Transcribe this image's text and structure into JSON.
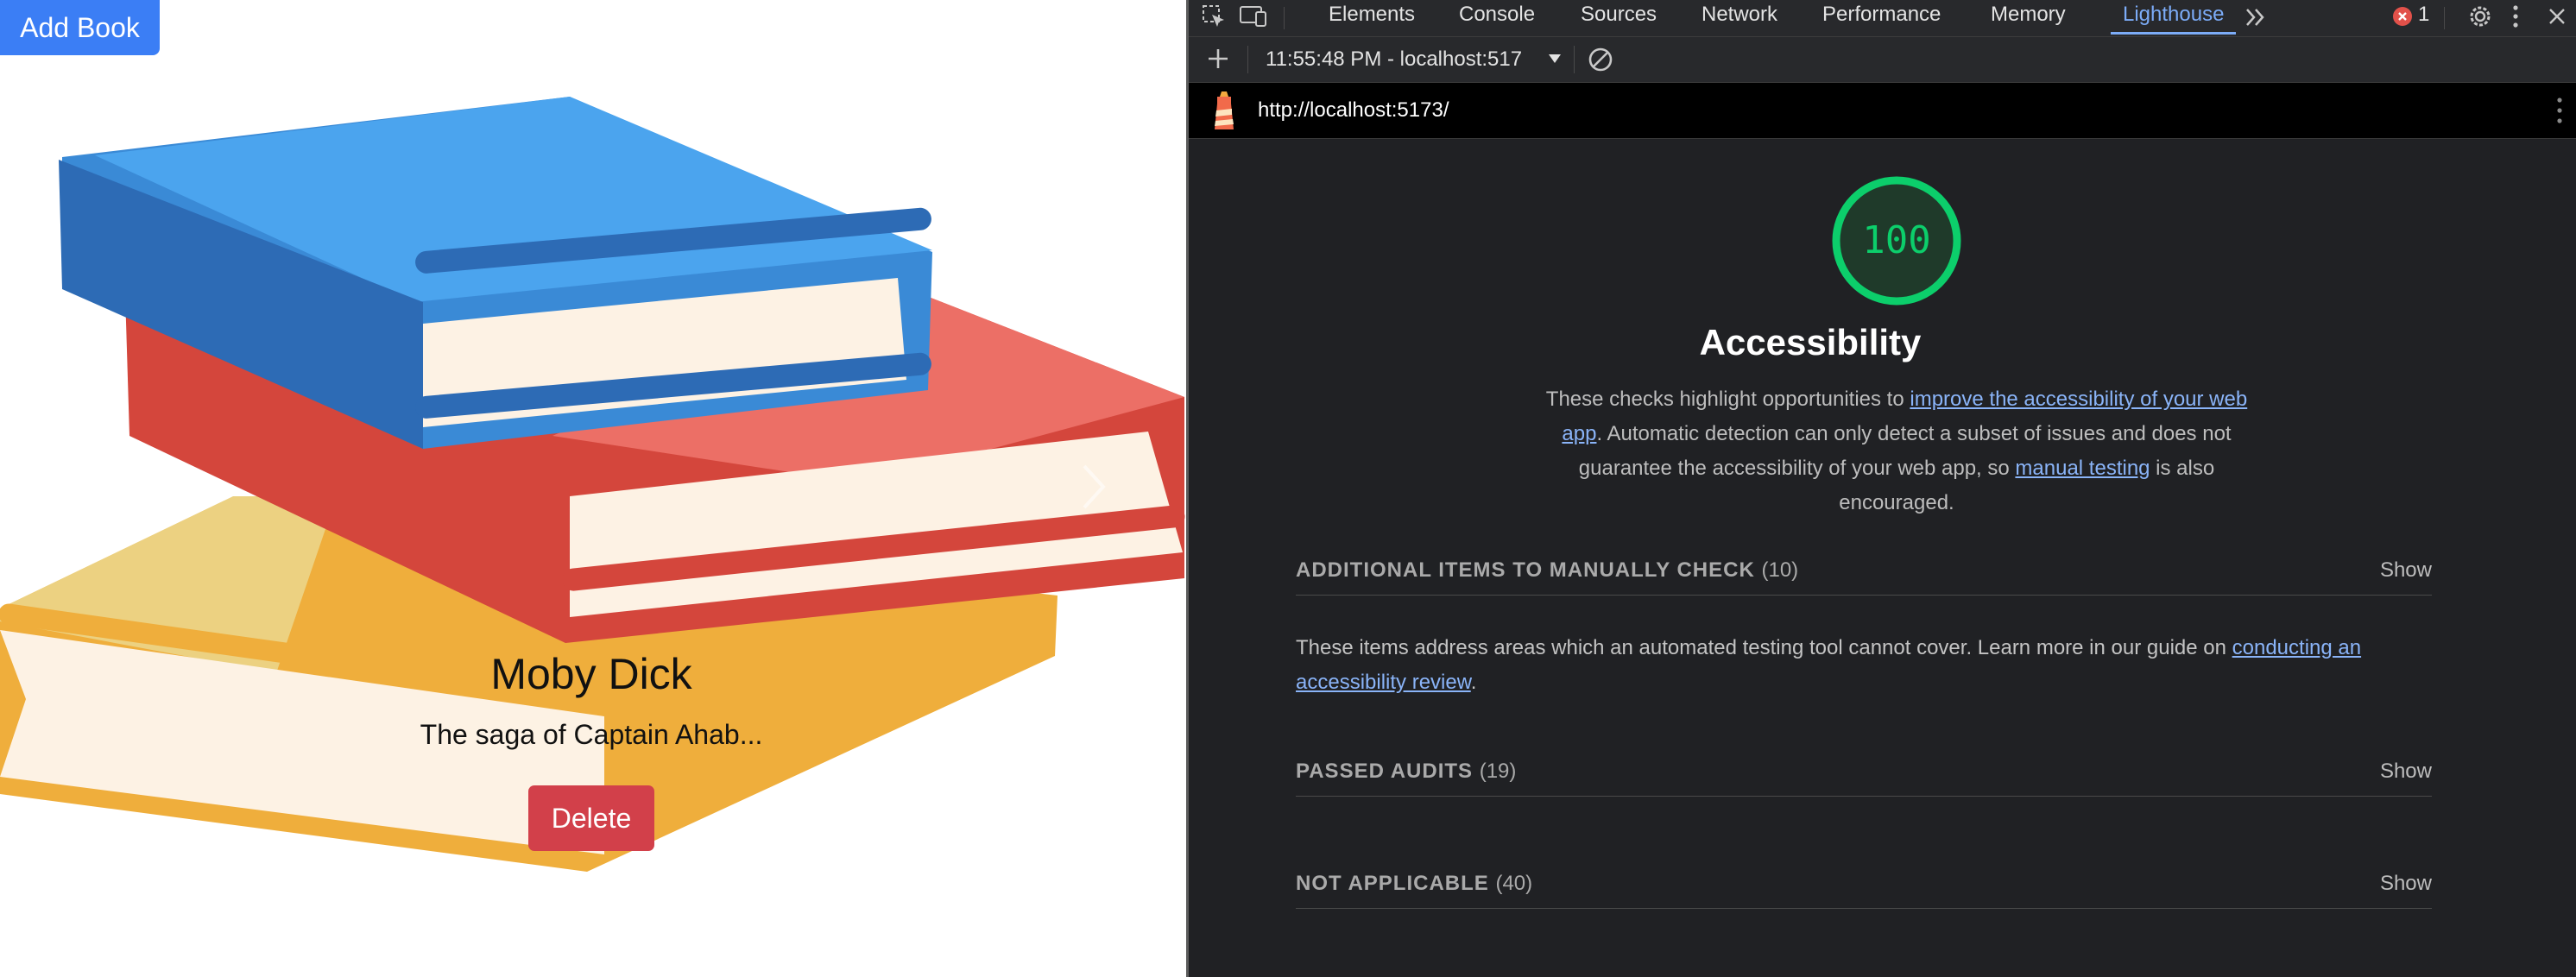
{
  "app": {
    "add_book_label": "Add Book",
    "book": {
      "title": "Moby Dick",
      "description": "The saga of Captain Ahab...",
      "delete_label": "Delete"
    }
  },
  "devtools": {
    "tabs": [
      "Elements",
      "Console",
      "Sources",
      "Network",
      "Performance",
      "Memory",
      "Lighthouse"
    ],
    "active_tab": "Lighthouse",
    "error_count": "1",
    "report_selector": "11:55:48 PM - localhost:517",
    "url": "http://localhost:5173/",
    "lighthouse": {
      "score": "100",
      "category_title": "Accessibility",
      "description": {
        "part1": "These checks highlight opportunities to ",
        "link1": "improve the accessibility of your web app",
        "part2": ". Automatic detection can only detect a subset of issues and does not guarantee the accessibility of your web app, so ",
        "link2": "manual testing",
        "part3": " is also encouraged."
      },
      "groups": {
        "manual": {
          "title": "ADDITIONAL ITEMS TO MANUALLY CHECK",
          "count": "(10)",
          "show": "Show"
        },
        "passed": {
          "title": "PASSED AUDITS",
          "count": "(19)",
          "show": "Show"
        },
        "not_applicable": {
          "title": "NOT APPLICABLE",
          "count": "(40)",
          "show": "Show"
        }
      },
      "manual_description": {
        "text": "These items address areas which an automated testing tool cannot cover. Learn more in our guide on ",
        "link": "conducting an accessibility review",
        "end": "."
      }
    }
  },
  "colors": {
    "primary_button": "#3b7ef5",
    "delete_button": "#d2404a",
    "score_green": "#0cce6b",
    "link_blue": "#8ab4f8",
    "active_tab": "#7cacf8"
  }
}
